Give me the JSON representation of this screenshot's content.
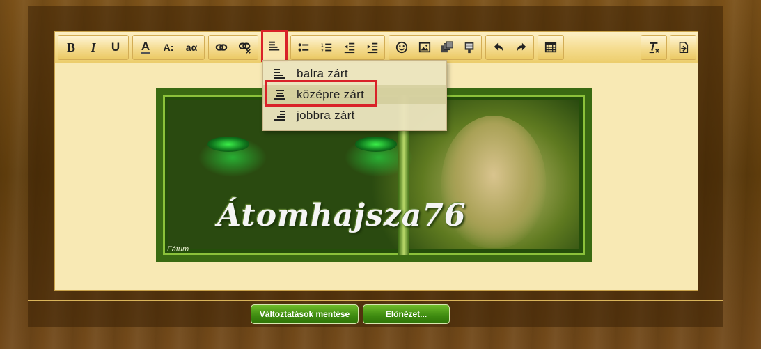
{
  "toolbar": {
    "buttons": [
      {
        "name": "bold-button",
        "icon": "bold-icon",
        "glyph": "B"
      },
      {
        "name": "italic-button",
        "icon": "italic-icon",
        "glyph": "I"
      },
      {
        "name": "underline-button",
        "icon": "underline-icon",
        "glyph": "U"
      },
      {
        "name": "font-color-button",
        "icon": "font-color-icon",
        "glyph": "A"
      },
      {
        "name": "font-size-button",
        "icon": "font-size-icon",
        "glyph": "A:"
      },
      {
        "name": "font-family-button",
        "icon": "font-family-icon",
        "glyph": "aα"
      },
      {
        "name": "link-button",
        "icon": "link-icon"
      },
      {
        "name": "unlink-button",
        "icon": "unlink-icon"
      },
      {
        "name": "align-button",
        "icon": "align-left-icon"
      },
      {
        "name": "bullet-list-button",
        "icon": "bullet-list-icon"
      },
      {
        "name": "numbered-list-button",
        "icon": "numbered-list-icon"
      },
      {
        "name": "outdent-button",
        "icon": "outdent-icon"
      },
      {
        "name": "indent-button",
        "icon": "indent-icon"
      },
      {
        "name": "emoji-button",
        "icon": "smiley-icon"
      },
      {
        "name": "image-button",
        "icon": "image-icon"
      },
      {
        "name": "media-button",
        "icon": "media-icon"
      },
      {
        "name": "quote-button",
        "icon": "quote-icon"
      },
      {
        "name": "undo-button",
        "icon": "undo-icon"
      },
      {
        "name": "redo-button",
        "icon": "redo-icon"
      },
      {
        "name": "table-button",
        "icon": "table-icon"
      },
      {
        "name": "clear-format-button",
        "icon": "clear-format-icon"
      },
      {
        "name": "source-button",
        "icon": "source-icon"
      }
    ]
  },
  "align_menu": {
    "items": [
      {
        "label": "balra zárt",
        "icon": "align-left-icon"
      },
      {
        "label": "középre zárt",
        "icon": "align-center-icon"
      },
      {
        "label": "jobbra zárt",
        "icon": "align-right-icon"
      }
    ]
  },
  "banner": {
    "title": "Átomhajsza76",
    "signature": "Fátum"
  },
  "actions": {
    "save_label": "Változtatások mentése",
    "preview_label": "Előnézet..."
  },
  "colors": {
    "accent_red": "#d92229",
    "toolbar_gold": "#f5dc8e",
    "editor_bg": "#f8e9b4",
    "button_green": "#3e8a10"
  }
}
